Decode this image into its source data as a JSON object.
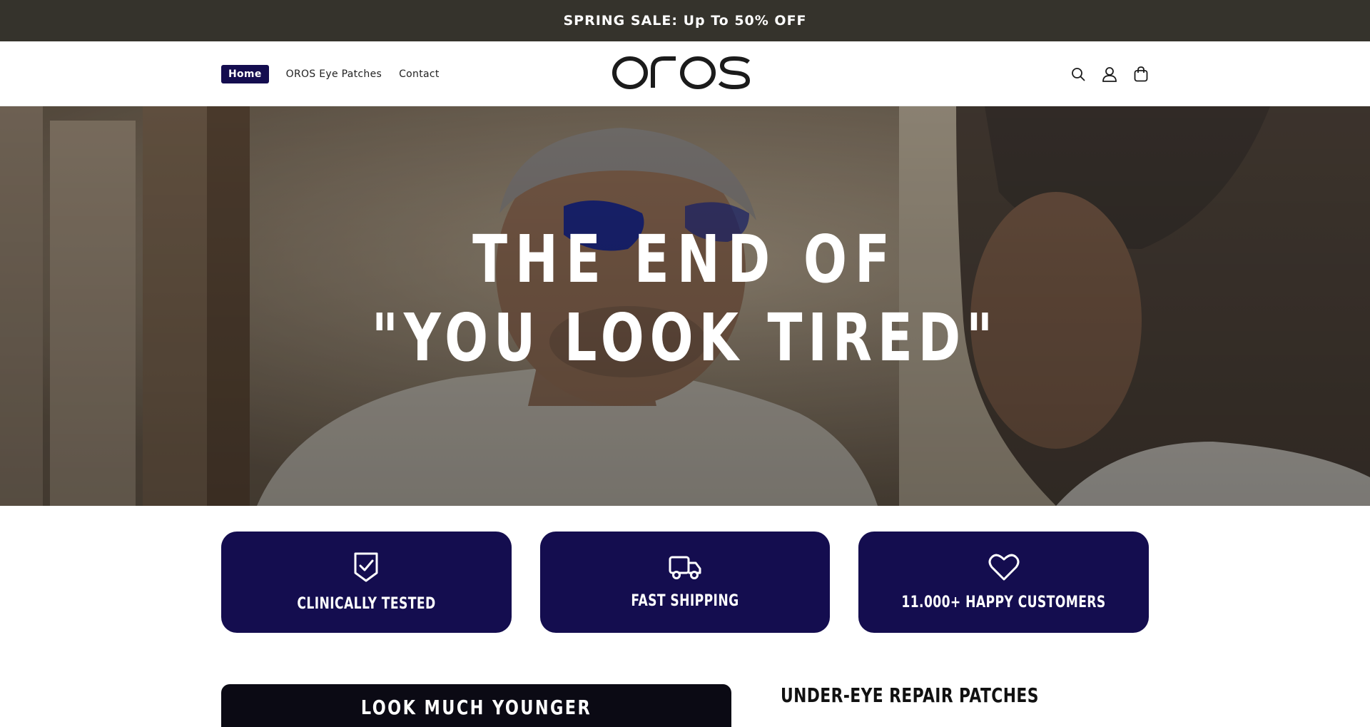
{
  "announcement": {
    "text": "SPRING SALE: Up To 50% OFF"
  },
  "header": {
    "nav": [
      {
        "label": "Home",
        "active": true
      },
      {
        "label": "OROS Eye Patches",
        "active": false
      },
      {
        "label": "Contact",
        "active": false
      }
    ],
    "logo_text": "OROS",
    "icons": [
      "search-icon",
      "account-icon",
      "cart-icon"
    ]
  },
  "hero": {
    "line1": "THE END OF",
    "line2": "\"YOU LOOK TIRED\""
  },
  "features": [
    {
      "icon": "shield-check-icon",
      "label": "CLINICALLY TESTED"
    },
    {
      "icon": "truck-icon",
      "label": "FAST SHIPPING"
    },
    {
      "icon": "heart-icon",
      "label": "11.000+ HAPPY CUSTOMERS"
    }
  ],
  "below": {
    "video_caption": "LOOK MUCH YOUNGER",
    "product_title": "UNDER-EYE REPAIR PATCHES"
  },
  "colors": {
    "announcement_bg": "#35332c",
    "brand_navy": "#140d4f",
    "text_dark": "#1b1b1b"
  }
}
